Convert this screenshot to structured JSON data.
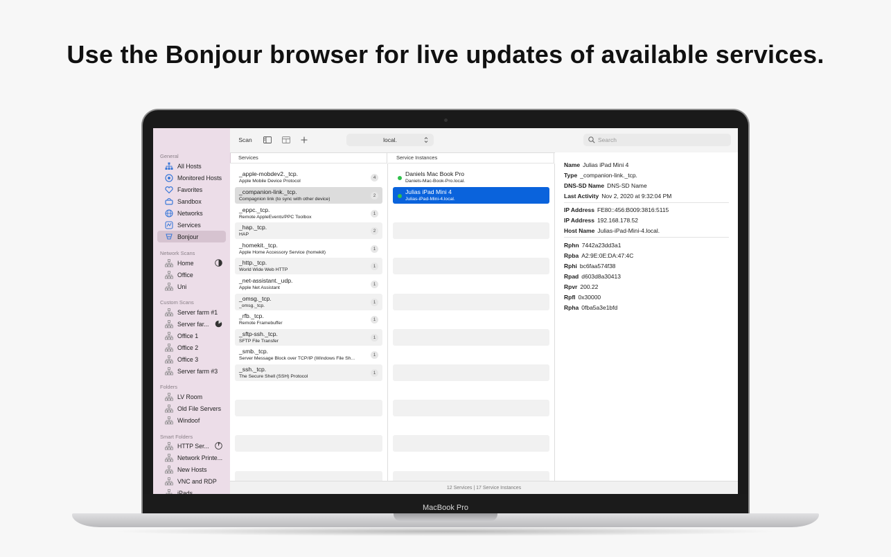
{
  "headline": "Use the Bonjour browser for live updates of available services.",
  "device_label": "MacBook Pro",
  "sidebar": {
    "sections": {
      "general": "General",
      "network_scans": "Network Scans",
      "custom_scans": "Custom Scans",
      "folders": "Folders",
      "smart_folders": "Smart Folders"
    },
    "general_items": [
      {
        "label": "All Hosts"
      },
      {
        "label": "Monitored Hosts"
      },
      {
        "label": "Favorites"
      },
      {
        "label": "Sandbox"
      },
      {
        "label": "Networks"
      },
      {
        "label": "Services"
      },
      {
        "label": "Bonjour",
        "selected": true
      }
    ],
    "network_scans": [
      {
        "label": "Home"
      },
      {
        "label": "Office"
      },
      {
        "label": "Uni"
      }
    ],
    "custom_scans": [
      {
        "label": "Server farm #1"
      },
      {
        "label": "Server far..."
      },
      {
        "label": "Office 1"
      },
      {
        "label": "Office 2"
      },
      {
        "label": "Office 3"
      },
      {
        "label": "Server farm #3"
      }
    ],
    "folders": [
      {
        "label": "LV Room"
      },
      {
        "label": "Old File Servers"
      },
      {
        "label": "Windoof"
      }
    ],
    "smart_folders": [
      {
        "label": "HTTP Ser..."
      },
      {
        "label": "Network Printe..."
      },
      {
        "label": "New Hosts"
      },
      {
        "label": "VNC and RDP"
      },
      {
        "label": "iPads"
      }
    ]
  },
  "toolbar": {
    "scan_label": "Scan",
    "scope_value": "local.",
    "search_placeholder": "Search"
  },
  "columns": {
    "services": "Services",
    "instances": "Service Instances"
  },
  "services": [
    {
      "name": "_apple-mobdev2._tcp.",
      "desc": "Apple Mobile Device Protocol",
      "count": "4"
    },
    {
      "name": "_companion-link._tcp.",
      "desc": "Compagnion link (to sync with other device)",
      "count": "2"
    },
    {
      "name": "_eppc._tcp.",
      "desc": "Remote AppleEvents/PPC Toolbox",
      "count": "1"
    },
    {
      "name": "_hap._tcp.",
      "desc": "HAP",
      "count": "2"
    },
    {
      "name": "_homekit._tcp.",
      "desc": "Apple Home Accessory Service (homekit)",
      "count": "1"
    },
    {
      "name": "_http._tcp.",
      "desc": "World Wide Web HTTP",
      "count": "1"
    },
    {
      "name": "_net-assistant._udp.",
      "desc": "Apple Net Assistant",
      "count": "1"
    },
    {
      "name": "_omsg._tcp.",
      "desc": "_omsg._tcp.",
      "count": "1"
    },
    {
      "name": "_rfb._tcp.",
      "desc": "Remote Framebuffer",
      "count": "1"
    },
    {
      "name": "_sftp-ssh._tcp.",
      "desc": "SFTP File Transfer",
      "count": "1"
    },
    {
      "name": "_smb._tcp.",
      "desc": "Server Message Block over TCP/IP (Windows File Sh...",
      "count": "1"
    },
    {
      "name": "_ssh._tcp.",
      "desc": "The Secure Shell (SSH) Protocol",
      "count": "1"
    }
  ],
  "instances": [
    {
      "name": "Daniels Mac Book Pro",
      "host": "Daniels-Mac-Book-Pro.local."
    },
    {
      "name": "Julias iPad Mini 4",
      "host": "Julias-iPad-Mini-4.local."
    }
  ],
  "details": {
    "name_label": "Name",
    "name": "Julias iPad Mini 4",
    "type_label": "Type",
    "type": "_companion-link._tcp.",
    "dnssd_label": "DNS-SD Name",
    "dnssd": "DNS-SD Name",
    "activity_label": "Last Activity",
    "activity": "Nov 2, 2020 at 9:32:04 PM",
    "ip1_label": "IP Address",
    "ip1": "FE80::456:B009:3816:5115",
    "ip2_label": "IP Address",
    "ip2": "192.168.178.52",
    "hostname_label": "Host Name",
    "hostname": "Julias-iPad-Mini-4.local.",
    "txt": [
      {
        "key": "Rphn",
        "value": "7442a23dd3a1"
      },
      {
        "key": "Rpba",
        "value": "A2:9E:0E:DA:47:4C"
      },
      {
        "key": "Rphi",
        "value": "bc6faa574f38"
      },
      {
        "key": "Rpad",
        "value": "d603d8a30413"
      },
      {
        "key": "Rpvr",
        "value": "200.22"
      },
      {
        "key": "Rpfl",
        "value": "0x30000"
      },
      {
        "key": "Rpha",
        "value": "0fba5a3e1bfd"
      }
    ]
  },
  "status": "12 Services | 17 Service Instances",
  "colors": {
    "accent": "#0a63dc",
    "sidebar_bg": "#ecdde8",
    "online": "#2fc14b"
  }
}
